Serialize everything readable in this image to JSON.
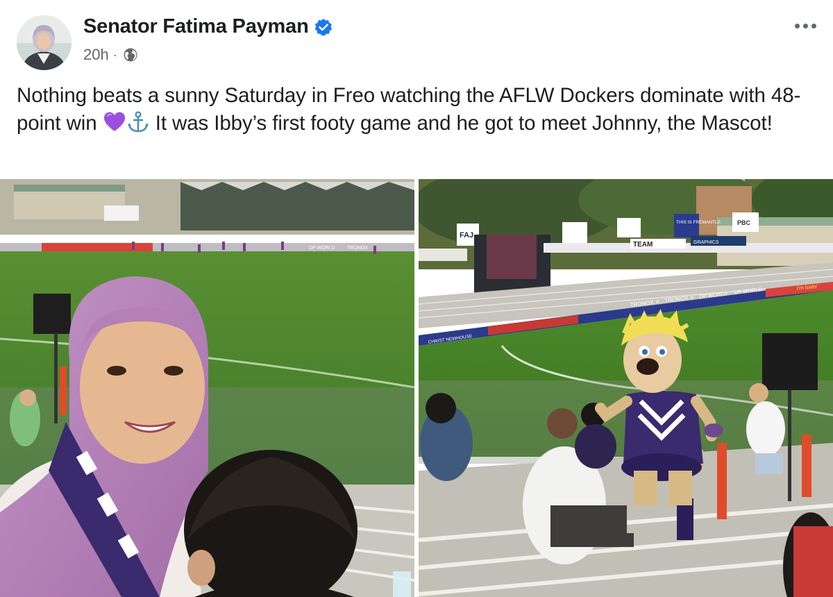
{
  "post": {
    "author": {
      "name": "Senator Fatima Payman",
      "verified": true,
      "avatar_icon": "profile-photo"
    },
    "meta": {
      "time": "20h",
      "separator": "·",
      "audience_icon": "globe-icon"
    },
    "more_icon": "more-horizontal-icon",
    "caption": {
      "part1": "Nothing beats a sunny Saturday in Freo watching the AFLW Dockers dominate with 48-point win ",
      "emoji1": "purple-heart-icon",
      "emoji2": "anchor-icon",
      "part2": " It was Ibby’s first footy game and he got to meet Johnny, the Mascot!"
    },
    "photos": [
      {
        "name": "selfie-at-stadium",
        "signage": [
          "DP WORLD",
          "TRONOX"
        ]
      },
      {
        "name": "mascot-johnny",
        "signage": [
          "FAJ",
          "THIS IS FREMANTLE",
          "PBC",
          "TEAM",
          "GRAPHICS",
          "TRONOX ⨯ · TRONOX ⨯",
          "DP WORLD",
          "DP WORLD",
          "i'm lovin'",
          "CHRIST NEWHOUSE"
        ]
      }
    ]
  },
  "colors": {
    "verified_blue": "#1877f2",
    "secondary_text": "#65676b",
    "grass": "#4f8a2f",
    "dockers_purple": "#3a2a6e"
  }
}
